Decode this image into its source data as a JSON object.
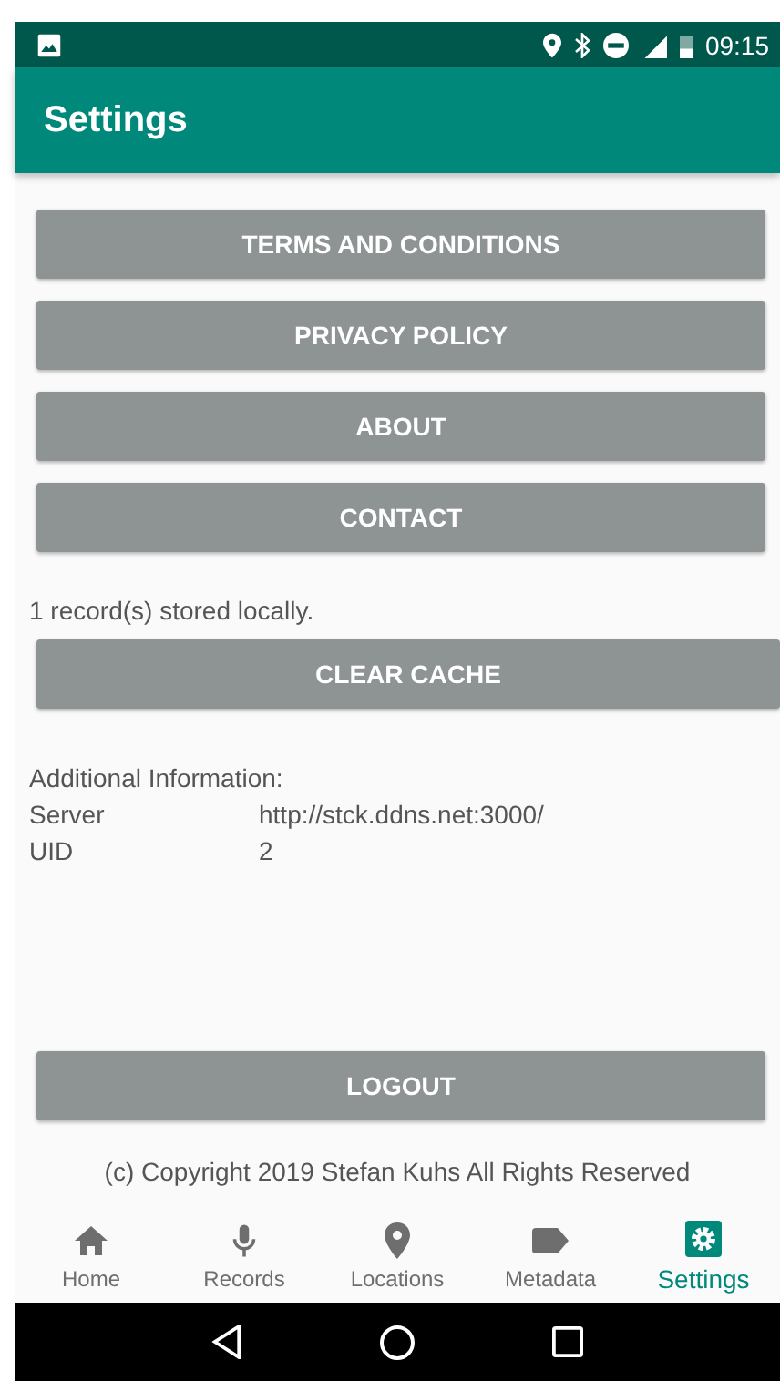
{
  "status_bar": {
    "time": "09:15"
  },
  "app_bar": {
    "title": "Settings"
  },
  "menu_buttons": [
    "TERMS AND CONDITIONS",
    "PRIVACY POLICY",
    "ABOUT",
    "CONTACT"
  ],
  "cache": {
    "message": "1 record(s) stored locally.",
    "button": "CLEAR CACHE"
  },
  "info": {
    "heading": "Additional Information:",
    "rows": [
      {
        "label": "Server",
        "value": "http://stck.ddns.net:3000/"
      },
      {
        "label": "UID",
        "value": "2"
      }
    ]
  },
  "logout_button": "LOGOUT",
  "copyright": "(c) Copyright 2019 Stefan Kuhs All Rights Reserved",
  "bottom_nav": [
    {
      "kind": "home",
      "label": "Home",
      "selected": false
    },
    {
      "kind": "mic",
      "label": "Records",
      "selected": false
    },
    {
      "kind": "pin",
      "label": "Locations",
      "selected": false
    },
    {
      "kind": "tag",
      "label": "Metadata",
      "selected": false
    },
    {
      "kind": "gear",
      "label": "Settings",
      "selected": true
    }
  ]
}
